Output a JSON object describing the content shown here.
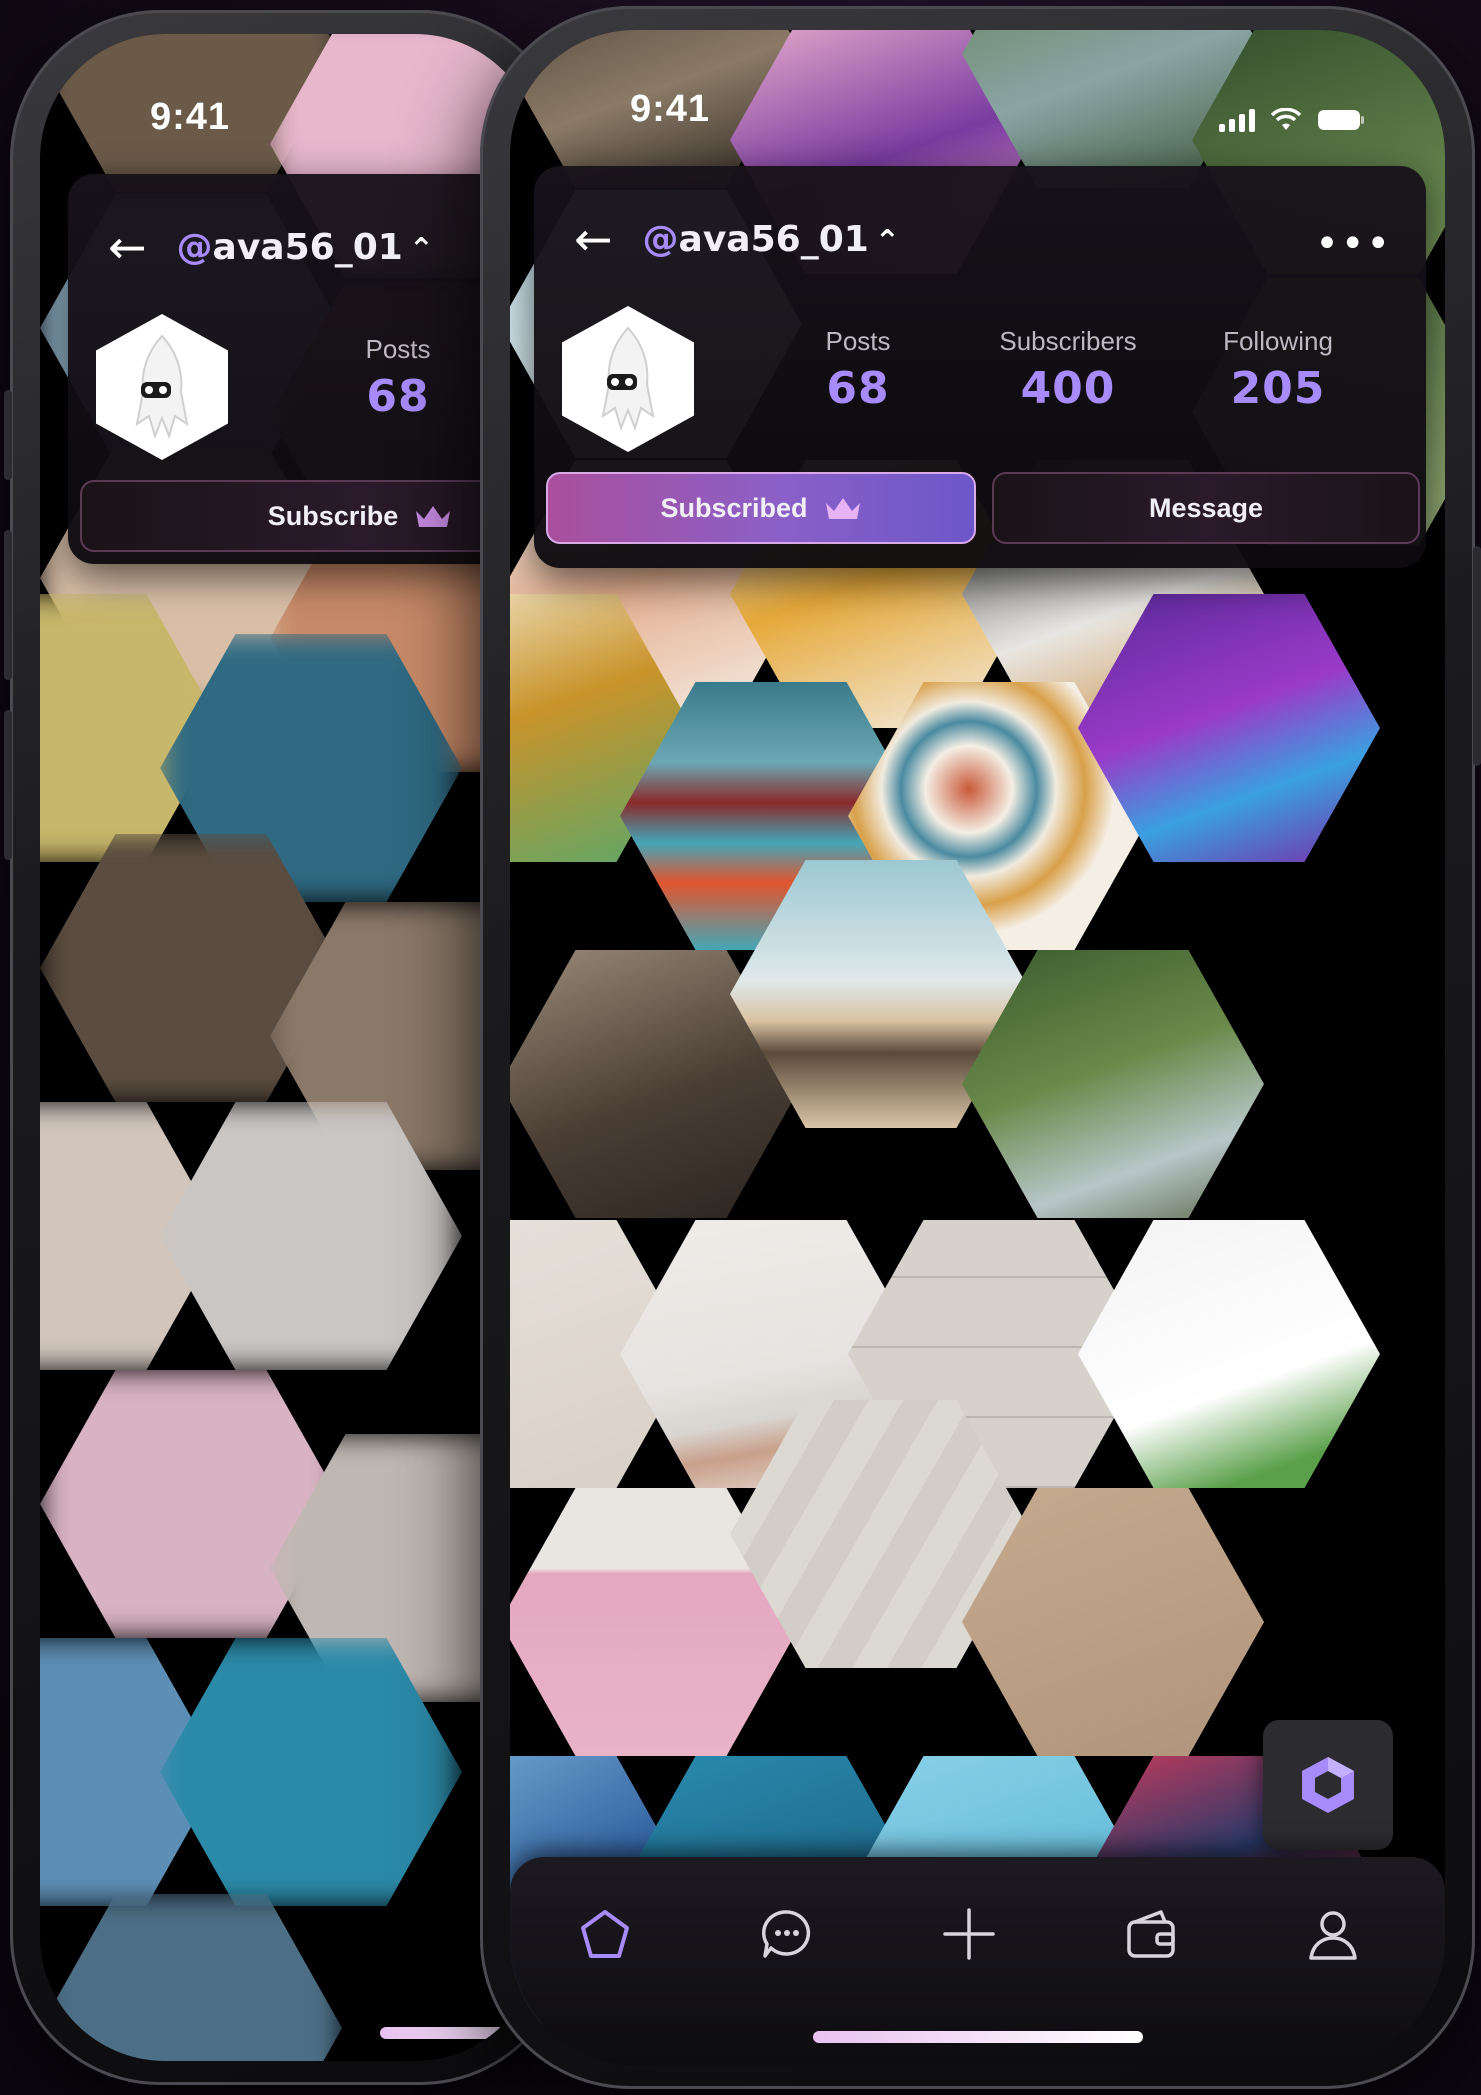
{
  "status_bar": {
    "time": "9:41"
  },
  "profile": {
    "username_at": "@",
    "username_rest": "ava56_01",
    "stats": [
      {
        "label": "Posts",
        "value": "68"
      },
      {
        "label": "Subscribers",
        "value": "400"
      },
      {
        "label": "Following",
        "value": "205"
      }
    ]
  },
  "back_screen": {
    "stat_label": "Posts",
    "stat_value": "68",
    "subscribe_label": "Subscribe"
  },
  "buttons": {
    "subscribed_label": "Subscribed",
    "message_label": "Message"
  },
  "icons": {
    "back": "arrow-left-icon",
    "expand": "chevron-up-icon",
    "more": "more-dots-icon",
    "crown": "crown-icon",
    "fab": "cube-icon",
    "tabs": [
      "home-icon",
      "chat-icon",
      "add-icon",
      "wallet-icon",
      "profile-icon"
    ]
  },
  "colors": {
    "accent": "#a78bfa",
    "button_gradient_start": "#a94f9c",
    "button_gradient_end": "#6b57c8",
    "background": "#140b18"
  }
}
